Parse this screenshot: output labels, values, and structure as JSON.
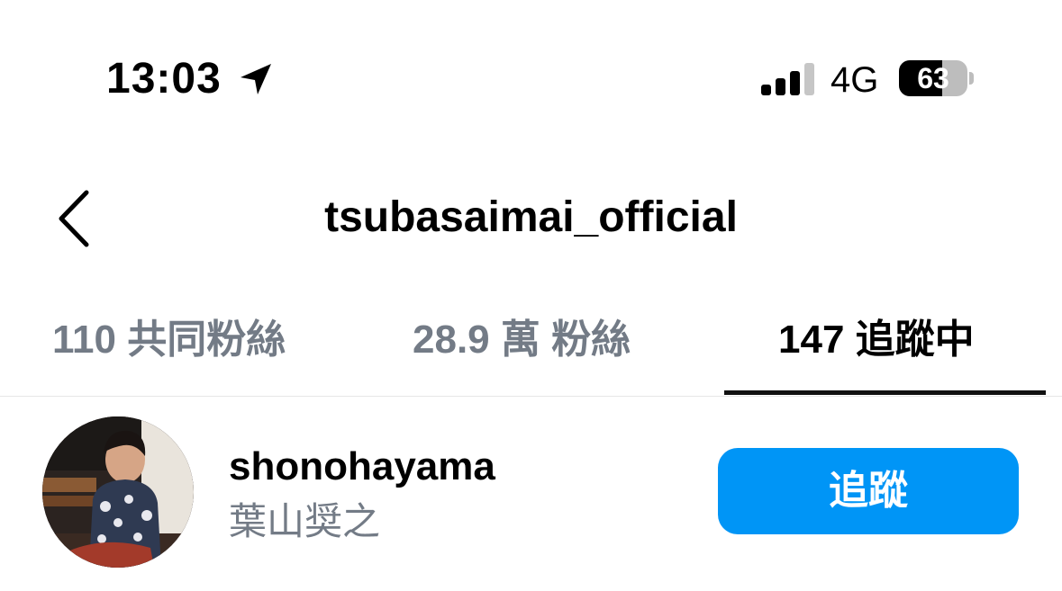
{
  "status_bar": {
    "time": "13:03",
    "location_icon": "location-arrow-icon",
    "signal_icon": "cellular-signal-icon",
    "signal_bars_active": 3,
    "signal_bars_total": 4,
    "network": "4G",
    "battery_level": "63",
    "battery_fraction": 0.63
  },
  "header": {
    "back_icon": "chevron-left-icon",
    "title": "tsubasaimai_official"
  },
  "tabs": [
    {
      "label": "110 共同粉絲",
      "active": false
    },
    {
      "label": "28.9 萬 粉絲",
      "active": false
    },
    {
      "label": "147 追蹤中",
      "active": true
    }
  ],
  "list": [
    {
      "username": "shonohayama",
      "display_name": "葉山奨之",
      "button_label": "追蹤"
    }
  ],
  "colors": {
    "accent": "#0095f6",
    "muted_text": "#737b86",
    "text": "#000000"
  }
}
